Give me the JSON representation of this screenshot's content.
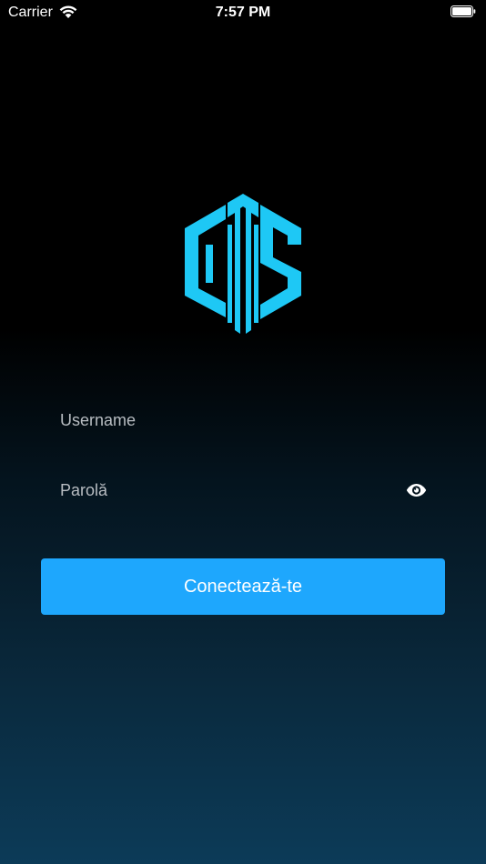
{
  "status_bar": {
    "carrier": "Carrier",
    "time": "7:57 PM",
    "wifi_icon": "wifi-icon",
    "battery_icon": "battery-icon"
  },
  "logo": {
    "name": "cms-logo",
    "text": "CMS",
    "color": "#1ec8f5"
  },
  "login": {
    "username_placeholder": "Username",
    "username_value": "",
    "password_placeholder": "Parolă",
    "password_value": "",
    "show_password_icon": "eye-icon",
    "submit_label": "Conectează-te"
  },
  "colors": {
    "accent": "#1ea7fd",
    "background_top": "#000000",
    "background_bottom": "#0c3b58",
    "placeholder": "#b8bdc2"
  }
}
